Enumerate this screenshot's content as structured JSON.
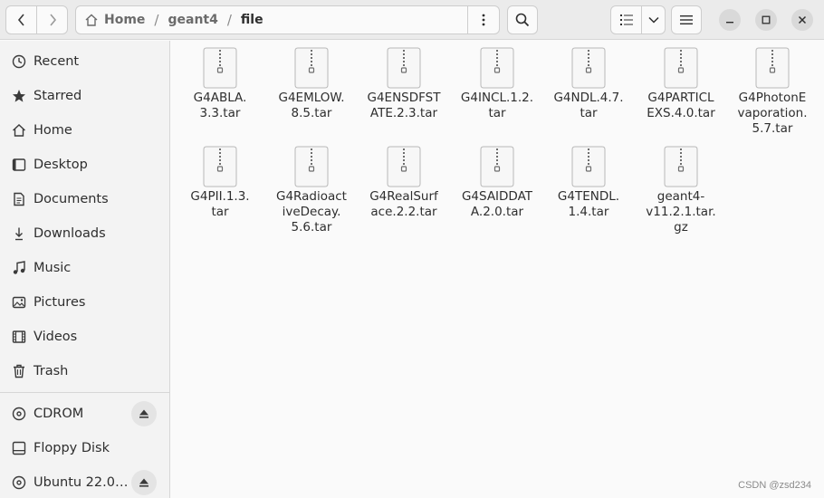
{
  "path": {
    "home": "Home",
    "parent": "geant4",
    "current": "file"
  },
  "sidebar": {
    "places": [
      {
        "label": "Recent",
        "icon": "clock-icon"
      },
      {
        "label": "Starred",
        "icon": "star-icon"
      },
      {
        "label": "Home",
        "icon": "home-icon"
      },
      {
        "label": "Desktop",
        "icon": "desktop-icon"
      },
      {
        "label": "Documents",
        "icon": "document-icon"
      },
      {
        "label": "Downloads",
        "icon": "download-icon"
      },
      {
        "label": "Music",
        "icon": "music-icon"
      },
      {
        "label": "Pictures",
        "icon": "picture-icon"
      },
      {
        "label": "Videos",
        "icon": "video-icon"
      },
      {
        "label": "Trash",
        "icon": "trash-icon"
      }
    ],
    "devices": [
      {
        "label": "CDROM",
        "icon": "disc-icon",
        "ejectable": true
      },
      {
        "label": "Floppy Disk",
        "icon": "drive-icon",
        "ejectable": false
      },
      {
        "label": "Ubuntu 22.0…",
        "icon": "disc-icon",
        "ejectable": true
      }
    ]
  },
  "files": [
    {
      "name": "G4ABLA.\n3.3.tar"
    },
    {
      "name": "G4EMLOW.\n8.5.tar"
    },
    {
      "name": "G4ENSDFST\nATE.2.3.tar"
    },
    {
      "name": "G4INCL.1.2.\ntar"
    },
    {
      "name": "G4NDL.4.7.\ntar"
    },
    {
      "name": "G4PARTICL\nEXS.4.0.tar"
    },
    {
      "name": "G4PhotonE\nvaporation.\n5.7.tar"
    },
    {
      "name": "G4PII.1.3.\ntar"
    },
    {
      "name": "G4Radioact\niveDecay.\n5.6.tar"
    },
    {
      "name": "G4RealSurf\nace.2.2.tar"
    },
    {
      "name": "G4SAIDDAT\nA.2.0.tar"
    },
    {
      "name": "G4TENDL.\n1.4.tar"
    },
    {
      "name": "geant4-\nv11.2.1.tar.\ngz"
    }
  ],
  "watermark": "CSDN @zsd234"
}
